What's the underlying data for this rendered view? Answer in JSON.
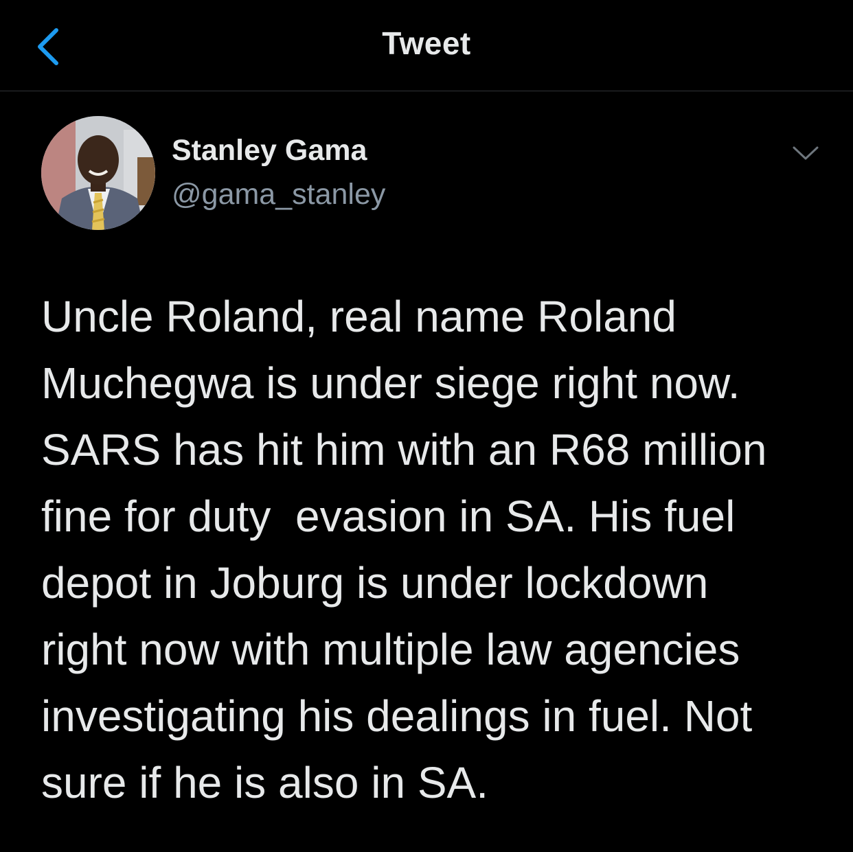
{
  "header": {
    "title": "Tweet",
    "back_icon": "chevron-left-icon",
    "accent_color": "#1d9bf0"
  },
  "tweet": {
    "author": {
      "name": "Stanley Gama",
      "handle": "@gama_stanley"
    },
    "more_icon": "chevron-down-icon",
    "text_lines": [
      "Uncle Roland, real name Roland",
      "Muchegwa is under siege right now.",
      "SARS has hit him with an R68 million",
      "fine for duty  evasion in SA. His fuel",
      "depot in Joburg is under lockdown",
      "right now with multiple law agencies",
      "investigating his dealings in fuel. Not",
      "sure if he is also in SA."
    ]
  }
}
